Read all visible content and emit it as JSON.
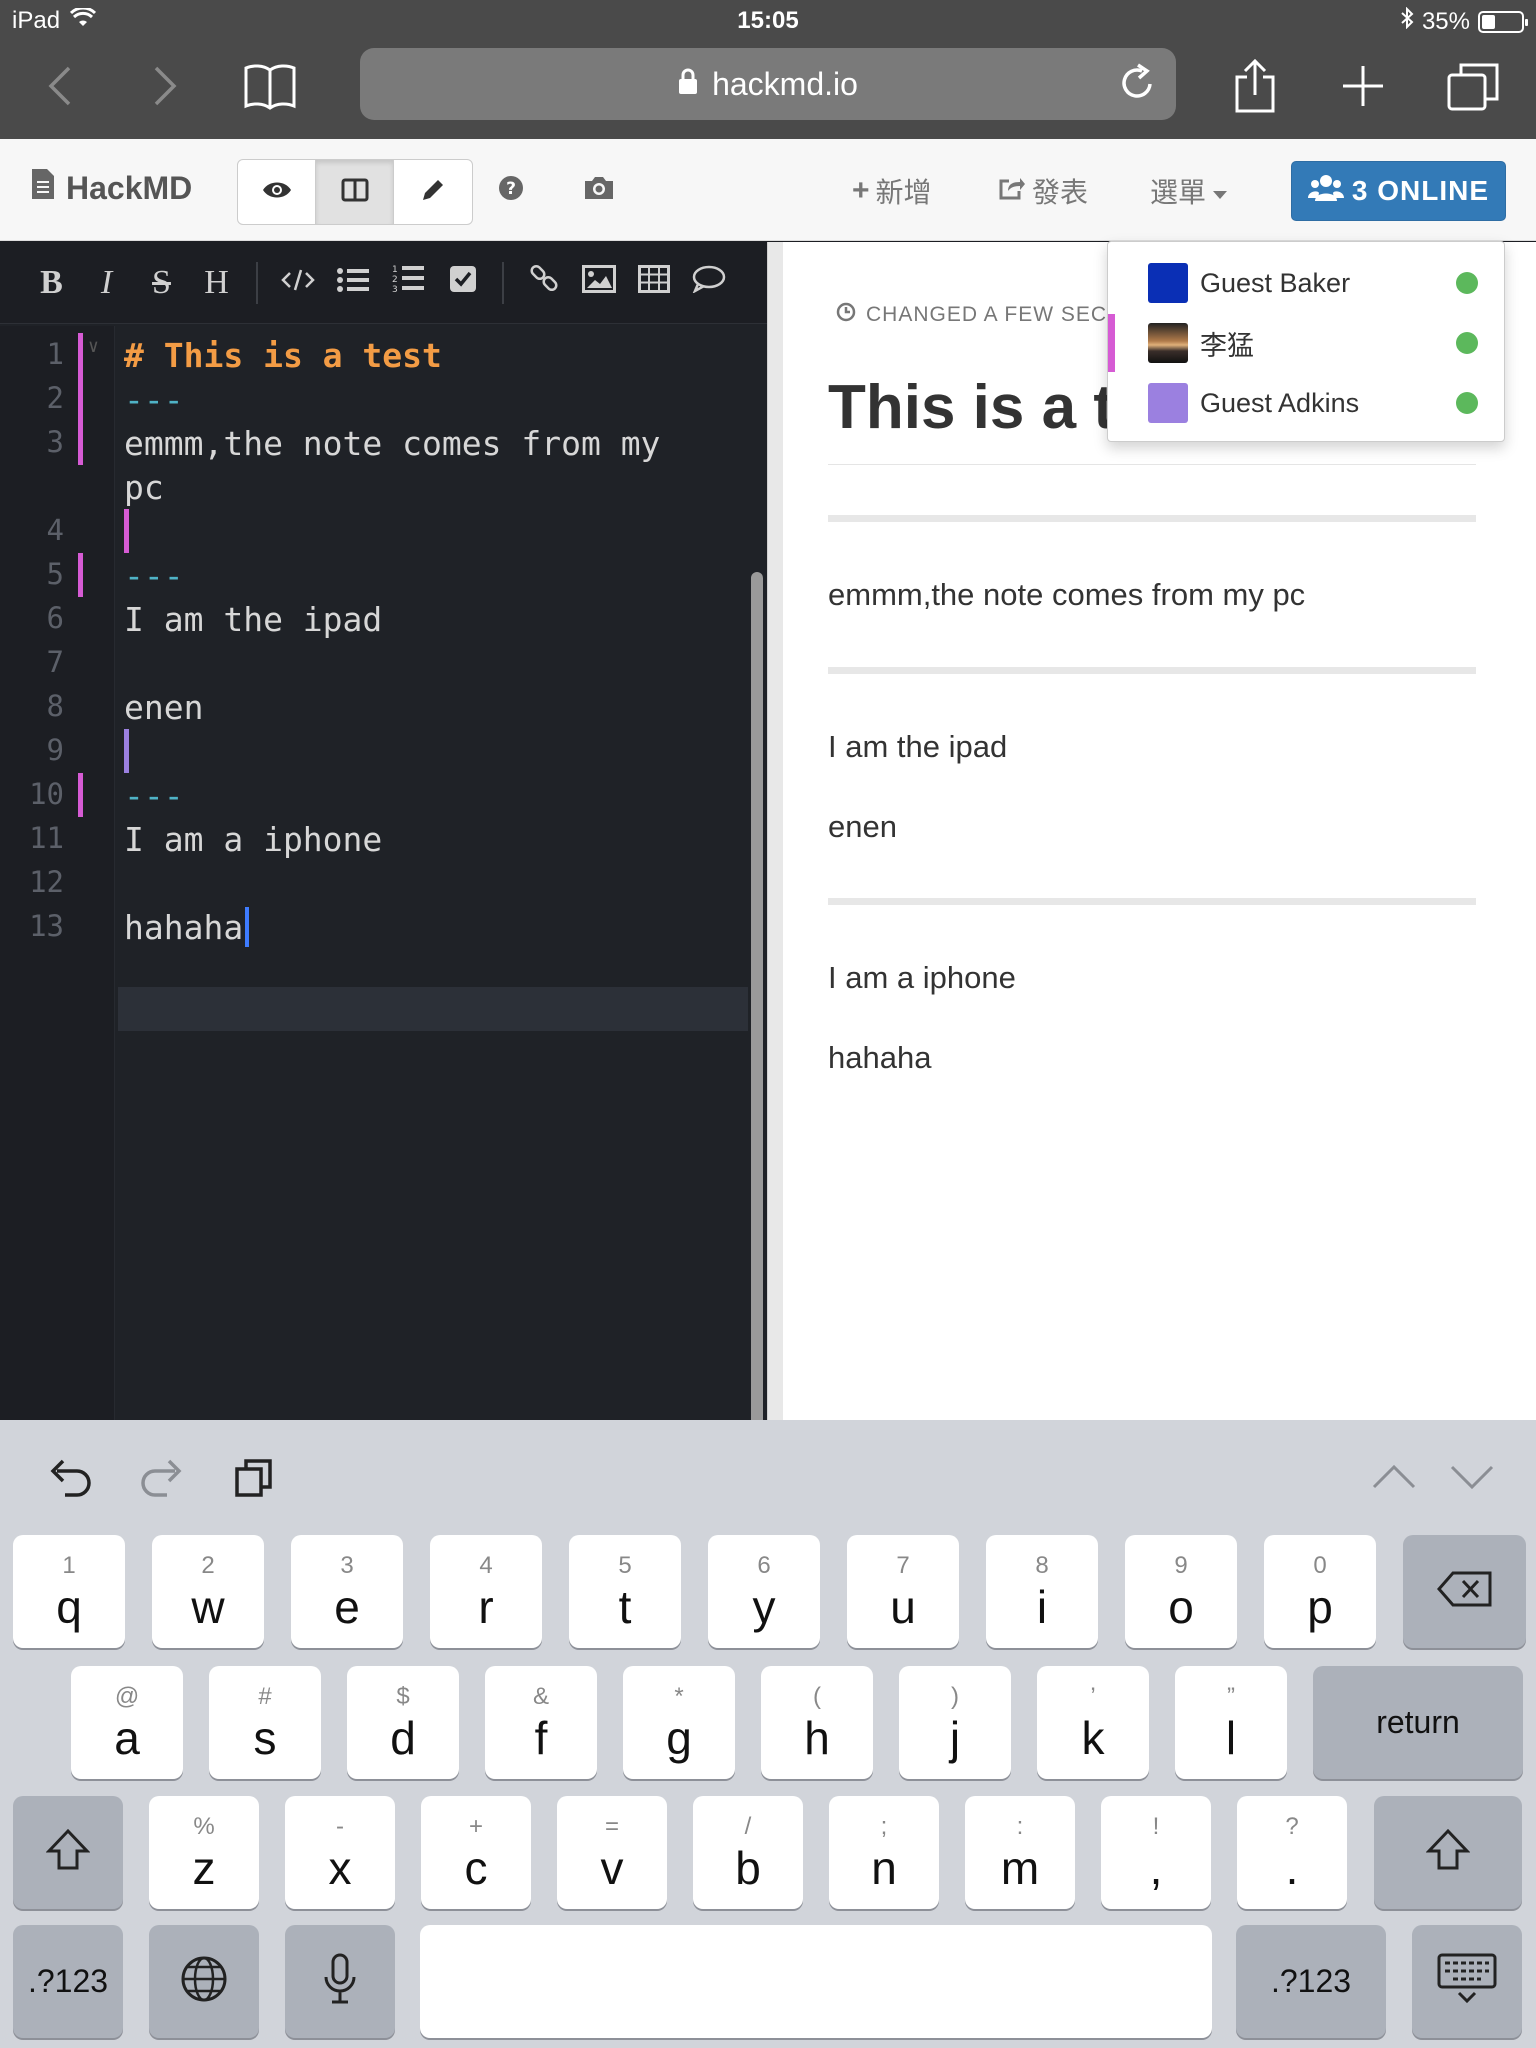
{
  "status_bar": {
    "device": "iPad",
    "time": "15:05",
    "battery_percent": "35%",
    "battery_level": 0.35
  },
  "safari": {
    "url": "hackmd.io"
  },
  "header": {
    "brand": "HackMD",
    "new_label": "新增",
    "publish_label": "發表",
    "menu_label": "選單",
    "online_label": "3 ONLINE"
  },
  "online_users": [
    {
      "name": "Guest Baker",
      "color": "#0a2fb5"
    },
    {
      "name": "李猛",
      "color": "#6b5a52"
    },
    {
      "name": "Guest Adkins",
      "color": "#9b80e0"
    }
  ],
  "editor": {
    "lines": [
      {
        "n": "1",
        "text": "# This is a test"
      },
      {
        "n": "2",
        "text": "---"
      },
      {
        "n": "3",
        "text": "emmm,the note comes from my"
      },
      {
        "n": "",
        "text": "pc"
      },
      {
        "n": "4",
        "text": ""
      },
      {
        "n": "5",
        "text": "---"
      },
      {
        "n": "6",
        "text": "I am the ipad"
      },
      {
        "n": "7",
        "text": ""
      },
      {
        "n": "8",
        "text": "enen"
      },
      {
        "n": "9",
        "text": ""
      },
      {
        "n": "10",
        "text": "---"
      },
      {
        "n": "11",
        "text": "I am a iphone"
      },
      {
        "n": "12",
        "text": ""
      },
      {
        "n": "13",
        "text": "hahaha"
      }
    ],
    "author_colors": {
      "pink": "#d65bd4",
      "purple": "#9b80e0"
    }
  },
  "preview": {
    "changed": "CHANGED A FEW SECO",
    "title": "This is a te",
    "paragraphs": [
      "emmm,the note comes from my pc",
      "I am the ipad",
      "enen",
      "I am a iphone",
      "hahaha"
    ]
  },
  "keyboard": {
    "row1": [
      {
        "h": "1",
        "k": "q"
      },
      {
        "h": "2",
        "k": "w"
      },
      {
        "h": "3",
        "k": "e"
      },
      {
        "h": "4",
        "k": "r"
      },
      {
        "h": "5",
        "k": "t"
      },
      {
        "h": "6",
        "k": "y"
      },
      {
        "h": "7",
        "k": "u"
      },
      {
        "h": "8",
        "k": "i"
      },
      {
        "h": "9",
        "k": "o"
      },
      {
        "h": "0",
        "k": "p"
      }
    ],
    "row2": [
      {
        "h": "@",
        "k": "a"
      },
      {
        "h": "#",
        "k": "s"
      },
      {
        "h": "$",
        "k": "d"
      },
      {
        "h": "&",
        "k": "f"
      },
      {
        "h": "*",
        "k": "g"
      },
      {
        "h": "(",
        "k": "h"
      },
      {
        "h": ")",
        "k": "j"
      },
      {
        "h": "’",
        "k": "k"
      },
      {
        "h": "”",
        "k": "l"
      }
    ],
    "row3": [
      {
        "h": "%",
        "k": "z"
      },
      {
        "h": "-",
        "k": "x"
      },
      {
        "h": "+",
        "k": "c"
      },
      {
        "h": "=",
        "k": "v"
      },
      {
        "h": "/",
        "k": "b"
      },
      {
        "h": ";",
        "k": "n"
      },
      {
        "h": ":",
        "k": "m"
      },
      {
        "h": "!",
        "k": ","
      },
      {
        "h": "?",
        "k": "."
      }
    ],
    "return_label": "return",
    "numbers_label": ".?123"
  }
}
